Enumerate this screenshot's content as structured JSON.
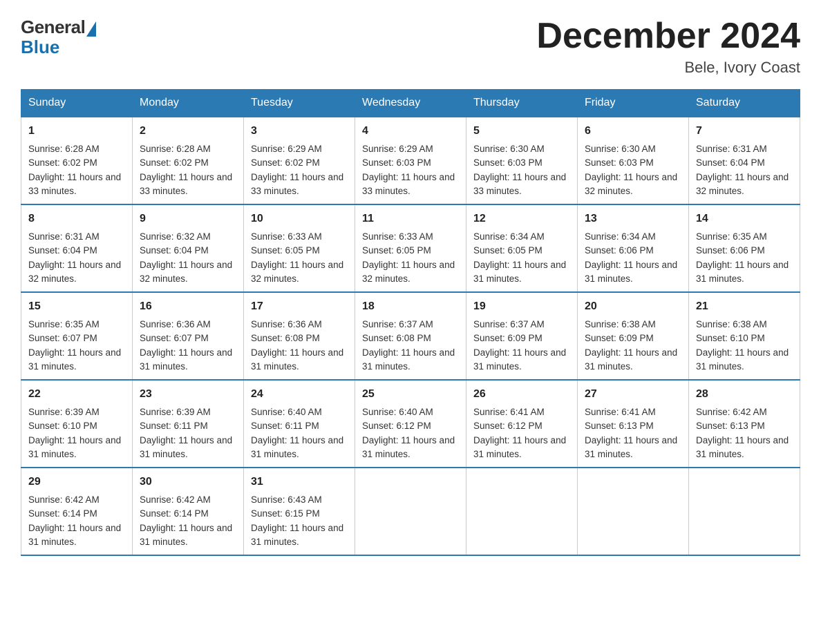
{
  "logo": {
    "general_text": "General",
    "blue_text": "Blue"
  },
  "header": {
    "month_year": "December 2024",
    "location": "Bele, Ivory Coast"
  },
  "days_of_week": [
    "Sunday",
    "Monday",
    "Tuesday",
    "Wednesday",
    "Thursday",
    "Friday",
    "Saturday"
  ],
  "weeks": [
    [
      {
        "day": "1",
        "sunrise": "6:28 AM",
        "sunset": "6:02 PM",
        "daylight": "11 hours and 33 minutes."
      },
      {
        "day": "2",
        "sunrise": "6:28 AM",
        "sunset": "6:02 PM",
        "daylight": "11 hours and 33 minutes."
      },
      {
        "day": "3",
        "sunrise": "6:29 AM",
        "sunset": "6:02 PM",
        "daylight": "11 hours and 33 minutes."
      },
      {
        "day": "4",
        "sunrise": "6:29 AM",
        "sunset": "6:03 PM",
        "daylight": "11 hours and 33 minutes."
      },
      {
        "day": "5",
        "sunrise": "6:30 AM",
        "sunset": "6:03 PM",
        "daylight": "11 hours and 33 minutes."
      },
      {
        "day": "6",
        "sunrise": "6:30 AM",
        "sunset": "6:03 PM",
        "daylight": "11 hours and 32 minutes."
      },
      {
        "day": "7",
        "sunrise": "6:31 AM",
        "sunset": "6:04 PM",
        "daylight": "11 hours and 32 minutes."
      }
    ],
    [
      {
        "day": "8",
        "sunrise": "6:31 AM",
        "sunset": "6:04 PM",
        "daylight": "11 hours and 32 minutes."
      },
      {
        "day": "9",
        "sunrise": "6:32 AM",
        "sunset": "6:04 PM",
        "daylight": "11 hours and 32 minutes."
      },
      {
        "day": "10",
        "sunrise": "6:33 AM",
        "sunset": "6:05 PM",
        "daylight": "11 hours and 32 minutes."
      },
      {
        "day": "11",
        "sunrise": "6:33 AM",
        "sunset": "6:05 PM",
        "daylight": "11 hours and 32 minutes."
      },
      {
        "day": "12",
        "sunrise": "6:34 AM",
        "sunset": "6:05 PM",
        "daylight": "11 hours and 31 minutes."
      },
      {
        "day": "13",
        "sunrise": "6:34 AM",
        "sunset": "6:06 PM",
        "daylight": "11 hours and 31 minutes."
      },
      {
        "day": "14",
        "sunrise": "6:35 AM",
        "sunset": "6:06 PM",
        "daylight": "11 hours and 31 minutes."
      }
    ],
    [
      {
        "day": "15",
        "sunrise": "6:35 AM",
        "sunset": "6:07 PM",
        "daylight": "11 hours and 31 minutes."
      },
      {
        "day": "16",
        "sunrise": "6:36 AM",
        "sunset": "6:07 PM",
        "daylight": "11 hours and 31 minutes."
      },
      {
        "day": "17",
        "sunrise": "6:36 AM",
        "sunset": "6:08 PM",
        "daylight": "11 hours and 31 minutes."
      },
      {
        "day": "18",
        "sunrise": "6:37 AM",
        "sunset": "6:08 PM",
        "daylight": "11 hours and 31 minutes."
      },
      {
        "day": "19",
        "sunrise": "6:37 AM",
        "sunset": "6:09 PM",
        "daylight": "11 hours and 31 minutes."
      },
      {
        "day": "20",
        "sunrise": "6:38 AM",
        "sunset": "6:09 PM",
        "daylight": "11 hours and 31 minutes."
      },
      {
        "day": "21",
        "sunrise": "6:38 AM",
        "sunset": "6:10 PM",
        "daylight": "11 hours and 31 minutes."
      }
    ],
    [
      {
        "day": "22",
        "sunrise": "6:39 AM",
        "sunset": "6:10 PM",
        "daylight": "11 hours and 31 minutes."
      },
      {
        "day": "23",
        "sunrise": "6:39 AM",
        "sunset": "6:11 PM",
        "daylight": "11 hours and 31 minutes."
      },
      {
        "day": "24",
        "sunrise": "6:40 AM",
        "sunset": "6:11 PM",
        "daylight": "11 hours and 31 minutes."
      },
      {
        "day": "25",
        "sunrise": "6:40 AM",
        "sunset": "6:12 PM",
        "daylight": "11 hours and 31 minutes."
      },
      {
        "day": "26",
        "sunrise": "6:41 AM",
        "sunset": "6:12 PM",
        "daylight": "11 hours and 31 minutes."
      },
      {
        "day": "27",
        "sunrise": "6:41 AM",
        "sunset": "6:13 PM",
        "daylight": "11 hours and 31 minutes."
      },
      {
        "day": "28",
        "sunrise": "6:42 AM",
        "sunset": "6:13 PM",
        "daylight": "11 hours and 31 minutes."
      }
    ],
    [
      {
        "day": "29",
        "sunrise": "6:42 AM",
        "sunset": "6:14 PM",
        "daylight": "11 hours and 31 minutes."
      },
      {
        "day": "30",
        "sunrise": "6:42 AM",
        "sunset": "6:14 PM",
        "daylight": "11 hours and 31 minutes."
      },
      {
        "day": "31",
        "sunrise": "6:43 AM",
        "sunset": "6:15 PM",
        "daylight": "11 hours and 31 minutes."
      },
      null,
      null,
      null,
      null
    ]
  ],
  "labels": {
    "sunrise_prefix": "Sunrise: ",
    "sunset_prefix": "Sunset: ",
    "daylight_prefix": "Daylight: "
  }
}
